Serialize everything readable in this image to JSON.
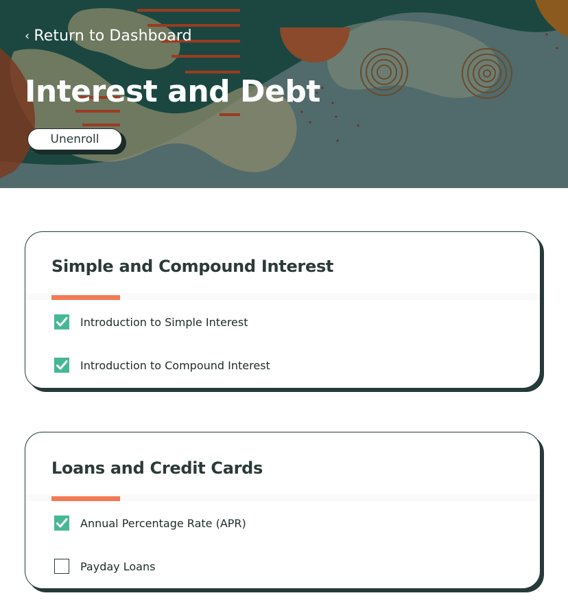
{
  "header": {
    "back_link": "Return to Dashboard",
    "back_chevron": "‹",
    "title": "Interest and Debt",
    "unenroll_label": "Unenroll"
  },
  "modules": [
    {
      "title": "Simple and Compound Interest",
      "lessons": [
        {
          "label": "Introduction to Simple Interest",
          "completed": true
        },
        {
          "label": "Introduction to Compound Interest",
          "completed": true
        }
      ]
    },
    {
      "title": "Loans and Credit Cards",
      "lessons": [
        {
          "label": "Annual Percentage Rate (APR)",
          "completed": true
        },
        {
          "label": "Payday Loans",
          "completed": false
        }
      ]
    }
  ],
  "colors": {
    "hero_bg": "#516a6b",
    "hero_dark": "#1b4740",
    "accent_orange": "#f27a54",
    "check_green": "#47b895",
    "text_dark": "#2b3a38"
  },
  "icons": {
    "back": "chevron-left-icon",
    "check": "checkmark-icon"
  }
}
